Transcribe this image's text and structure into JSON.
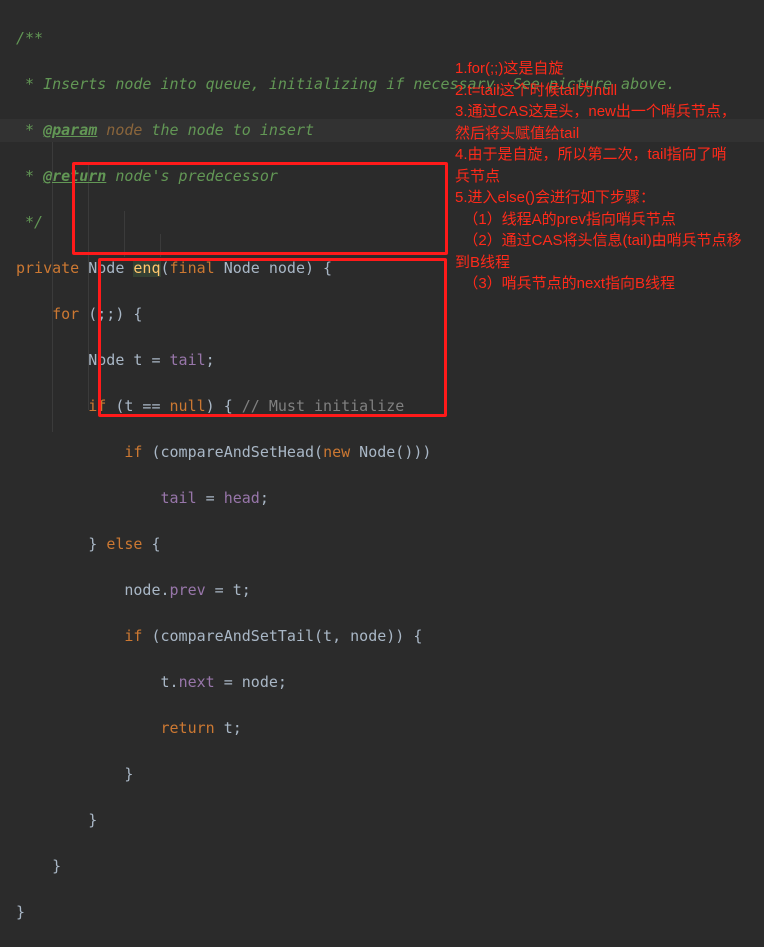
{
  "code": {
    "l1": "/**",
    "l2": " * Inserts node into queue, initializing if necessary. See picture above.",
    "l3_star": " * ",
    "l3_tag": "@param",
    "l3_name": " node",
    "l3_rest": " the node to insert",
    "l4_star": " * ",
    "l4_tag": "@return",
    "l4_rest": " node's predecessor",
    "l5": " */",
    "l6_kw": "private",
    "l6_a": " Node ",
    "l6_fn": "enq",
    "l6_b": "(",
    "l6_kw2": "final",
    "l6_c": " Node node) {",
    "l7_kw": "for",
    "l7_a": " (;;) {",
    "l8_a": "Node t = ",
    "l8_f": "tail",
    "l8_b": ";",
    "l9_kw": "if",
    "l9_a": " (t == ",
    "l9_kw2": "null",
    "l9_b": ") { ",
    "l9_cm": "// Must initialize",
    "l10_kw": "if",
    "l10_a": " (compareAndSetHead(",
    "l10_kw2": "new",
    "l10_b": " Node()))",
    "l11_f": "tail",
    "l11_a": " = ",
    "l11_f2": "head",
    "l11_b": ";",
    "l12_a": "} ",
    "l12_kw": "else",
    "l12_b": " {",
    "l13_a": "node.",
    "l13_f": "prev",
    "l13_b": " = t;",
    "l14_kw": "if",
    "l14_a": " (compareAndSetTail(t, node)) {",
    "l15_a": "t.",
    "l15_f": "next",
    "l15_b": " = node;",
    "l16_kw": "return",
    "l16_a": " t;",
    "l17": "}",
    "l18": "}",
    "l19": "}",
    "l20": "}"
  },
  "annotations": [
    "1.for(;;)这是自旋",
    "2.t=tail这个时候tail为null",
    "3.通过CAS这是头，new出一个哨兵节点，",
    "然后将头赋值给tail",
    "4.由于是自旋，所以第二次，tail指向了哨",
    "兵节点",
    "5.进入else()会进行如下步骤：",
    "  （1）线程A的prev指向哨兵节点",
    "  （2）通过CAS将头信息(tail)由哨兵节点移",
    "到B线程",
    "  （3）哨兵节点的next指向B线程"
  ],
  "colors": {
    "background": "#2b2b2b",
    "annotation": "#ff2a1a",
    "highlight_box": "#ff1a1a"
  }
}
